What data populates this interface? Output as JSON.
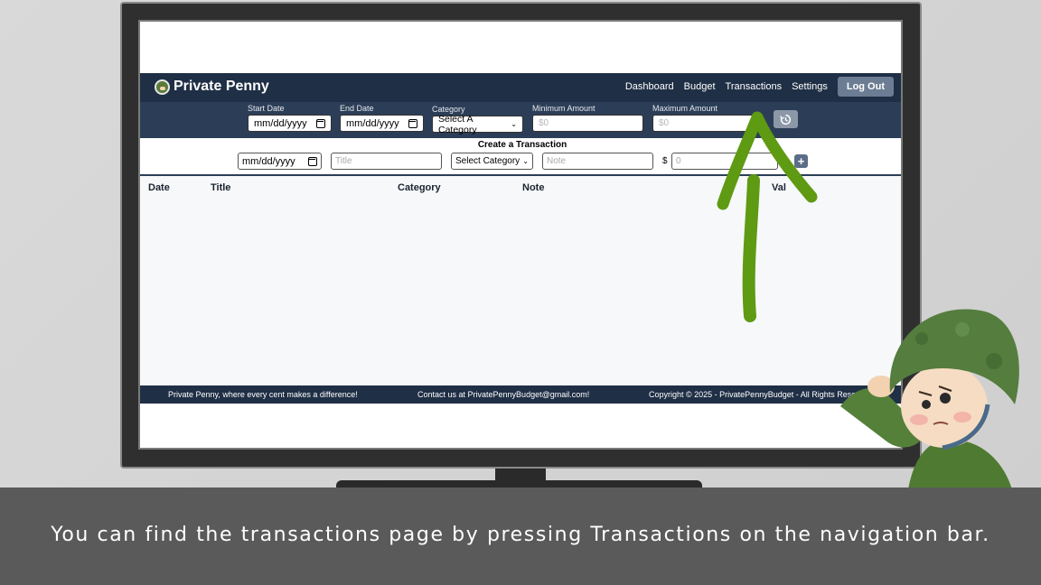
{
  "app": {
    "brand": "Private Penny",
    "nav": [
      "Dashboard",
      "Budget",
      "Transactions",
      "Settings"
    ],
    "logout": "Log Out"
  },
  "filters": {
    "start_date_label": "Start Date",
    "start_date_value": "mm/dd/yyyy",
    "end_date_label": "End Date",
    "end_date_value": "mm/dd/yyyy",
    "category_label": "Category",
    "category_value": "Select A Category",
    "min_amount_label": "Minimum Amount",
    "min_amount_placeholder": "$0",
    "max_amount_label": "Maximum Amount",
    "max_amount_placeholder": "$0",
    "history_icon": "history-icon"
  },
  "create": {
    "title": "Create a Transaction",
    "date_value": "mm/dd/yyyy",
    "title_placeholder": "Title",
    "category_value": "Select Category",
    "note_placeholder": "Note",
    "currency": "$",
    "amount_placeholder": "0",
    "add_label": "+"
  },
  "table": {
    "headers": [
      "Date",
      "Title",
      "Category",
      "Note",
      "Val"
    ]
  },
  "footer": {
    "tagline": "Private Penny, where every cent makes a difference!",
    "contact": "Contact us at PrivatePennyBudget@gmail.com!",
    "copyright": "Copyright © 2025 - PrivatePennyBudget - All Rights Reserve"
  },
  "caption": "You can find the transactions page by pressing Transactions on the navigation bar.",
  "colors": {
    "navbar": "#1f2f45",
    "filterbar": "#2c3e57",
    "arrow": "#5f9a13",
    "caption_bar": "#5a5a5a"
  }
}
